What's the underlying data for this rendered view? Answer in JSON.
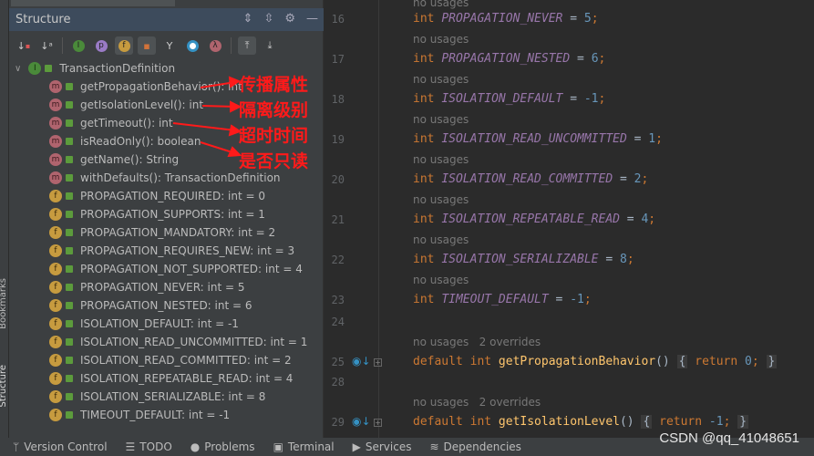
{
  "side_tabs": [
    "Bookmarks",
    "Structure"
  ],
  "panel": {
    "title": "Structure",
    "toolbar_icons": [
      "sort-visibility-icon",
      "sort-alpha-icon",
      "inherited-icon",
      "properties-icon",
      "fields-icon",
      "non-public-icon",
      "anonymous-icon",
      "lambda-icon",
      "circle-icon",
      "autoscroll-to-source-icon",
      "autoscroll-from-source-icon"
    ],
    "root": "TransactionDefinition",
    "items": [
      {
        "kind": "m",
        "label": "getPropagationBehavior(): int"
      },
      {
        "kind": "m",
        "label": "getIsolationLevel(): int"
      },
      {
        "kind": "m",
        "label": "getTimeout(): int"
      },
      {
        "kind": "m",
        "label": "isReadOnly(): boolean"
      },
      {
        "kind": "m",
        "label": "getName(): String"
      },
      {
        "kind": "m",
        "label": "withDefaults(): TransactionDefinition"
      },
      {
        "kind": "f",
        "label": "PROPAGATION_REQUIRED: int = 0"
      },
      {
        "kind": "f",
        "label": "PROPAGATION_SUPPORTS: int = 1"
      },
      {
        "kind": "f",
        "label": "PROPAGATION_MANDATORY: int = 2"
      },
      {
        "kind": "f",
        "label": "PROPAGATION_REQUIRES_NEW: int = 3"
      },
      {
        "kind": "f",
        "label": "PROPAGATION_NOT_SUPPORTED: int = 4"
      },
      {
        "kind": "f",
        "label": "PROPAGATION_NEVER: int = 5"
      },
      {
        "kind": "f",
        "label": "PROPAGATION_NESTED: int = 6"
      },
      {
        "kind": "f",
        "label": "ISOLATION_DEFAULT: int = -1"
      },
      {
        "kind": "f",
        "label": "ISOLATION_READ_UNCOMMITTED: int = 1"
      },
      {
        "kind": "f",
        "label": "ISOLATION_READ_COMMITTED: int = 2"
      },
      {
        "kind": "f",
        "label": "ISOLATION_REPEATABLE_READ: int = 4"
      },
      {
        "kind": "f",
        "label": "ISOLATION_SERIALIZABLE: int = 8"
      },
      {
        "kind": "f",
        "label": "TIMEOUT_DEFAULT: int = -1"
      }
    ]
  },
  "annotations": [
    "传播属性",
    "隔离级别",
    "超时时间",
    "是否只读"
  ],
  "editor": {
    "top_hint": "no usages",
    "consts": [
      {
        "line": "16",
        "name": "PROPAGATION_NEVER",
        "value": "5",
        "hint": "no usages"
      },
      {
        "line": "17",
        "name": "PROPAGATION_NESTED",
        "value": "6",
        "hint": "no usages"
      },
      {
        "line": "18",
        "name": "ISOLATION_DEFAULT",
        "value": "-1",
        "hint": "no usages"
      },
      {
        "line": "19",
        "name": "ISOLATION_READ_UNCOMMITTED",
        "value": "1",
        "hint": "no usages"
      },
      {
        "line": "20",
        "name": "ISOLATION_READ_COMMITTED",
        "value": "2",
        "hint": "no usages"
      },
      {
        "line": "21",
        "name": "ISOLATION_REPEATABLE_READ",
        "value": "4",
        "hint": "no usages"
      },
      {
        "line": "22",
        "name": "ISOLATION_SERIALIZABLE",
        "value": "8",
        "hint": "no usages"
      },
      {
        "line": "23",
        "name": "TIMEOUT_DEFAULT",
        "value": "-1",
        "hint": ""
      }
    ],
    "line24": "24",
    "line28": "28",
    "methods": [
      {
        "line": "25",
        "hint": "no usages   2 overrides",
        "name": "getPropagationBehavior",
        "ret": "0"
      },
      {
        "line": "29",
        "hint": "no usages   2 overrides",
        "name": "getIsolationLevel",
        "ret": "-1"
      }
    ]
  },
  "bottom": [
    "Version Control",
    "TODO",
    "Problems",
    "Terminal",
    "Services",
    "Dependencies"
  ],
  "watermark": "CSDN @qq_41048651"
}
